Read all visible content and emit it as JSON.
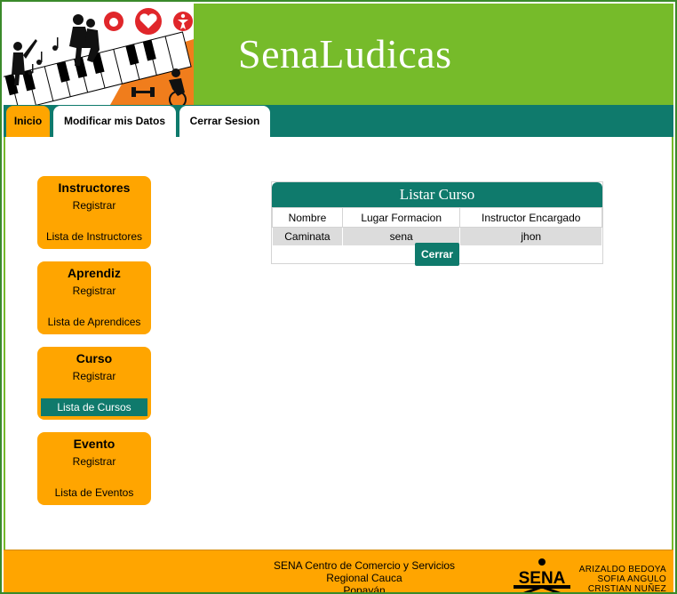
{
  "header": {
    "site_title": "SenaLudicas"
  },
  "tabs": [
    {
      "label": "Inicio",
      "active": true
    },
    {
      "label": "Modificar mis Datos",
      "active": false
    },
    {
      "label": "Cerrar Sesion",
      "active": false
    }
  ],
  "sidebar": [
    {
      "title": "Instructores",
      "register": "Registrar",
      "list": "Lista de Instructores",
      "active": false
    },
    {
      "title": "Aprendiz",
      "register": "Registrar",
      "list": "Lista de Aprendices",
      "active": false
    },
    {
      "title": "Curso",
      "register": "Registrar",
      "list": "Lista de Cursos",
      "active": true
    },
    {
      "title": "Evento",
      "register": "Registrar",
      "list": "Lista de Eventos",
      "active": false
    }
  ],
  "panel": {
    "title": "Listar Curso",
    "columns": [
      "Nombre",
      "Lugar Formacion",
      "Instructor Encargado"
    ],
    "rows": [
      [
        "Caminata",
        "sena",
        "jhon"
      ]
    ],
    "close_label": "Cerrar"
  },
  "footer": {
    "lines": [
      "SENA Centro de Comercio y Servicios",
      "Regional Cauca",
      "Popayán"
    ],
    "logo_text": "SENA",
    "credits": [
      "ARIZALDO BEDOYA",
      "SOFIA ANGULO",
      "CRISTIAN NUÑEZ"
    ]
  },
  "colors": {
    "header_green": "#76bb2a",
    "teal": "#0f7a6c",
    "orange": "#ffa500"
  }
}
